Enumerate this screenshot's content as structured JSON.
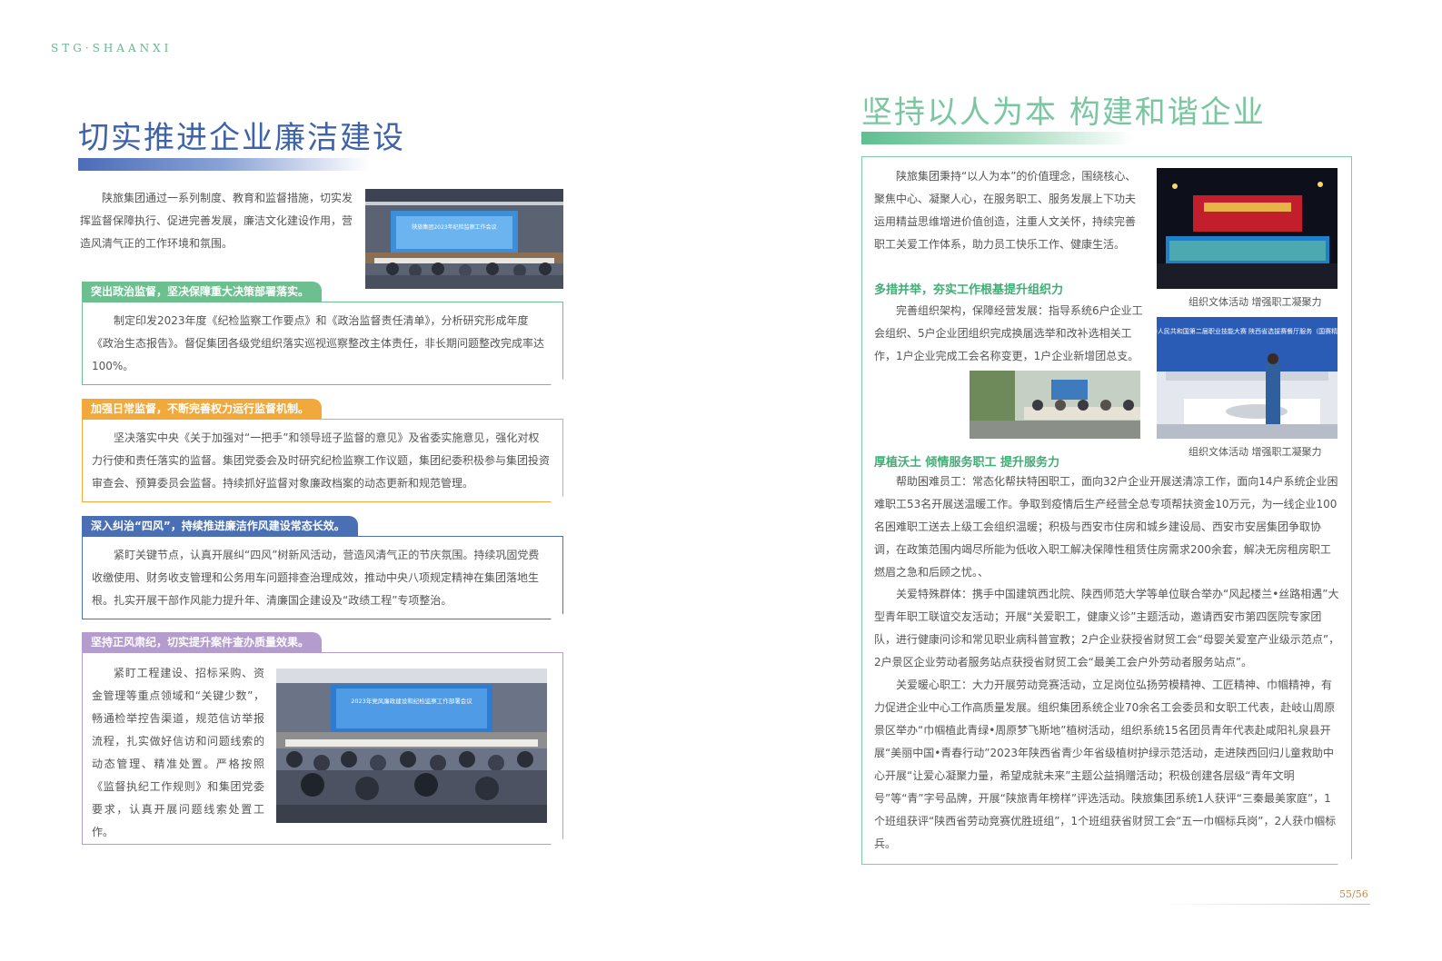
{
  "brand": "STG·SHAANXI",
  "left": {
    "title": "切实推进企业廉洁建设",
    "intro": "陕旅集团通过一系列制度、教育和监督措施，切实发挥监督保障执行、促进完善发展，廉洁文化建设作用，营造风清气正的工作环境和氛围。",
    "sections": [
      {
        "heading": "突出政治监督，坚决保障重大决策部署落实。",
        "body": "制定印发2023年度《纪检监察工作要点》和《政治监督责任清单》，分析研究形成年度《政治生态报告》。督促集团各级党组织落实巡视巡察整改主体责任，非长期问题整改完成率达100%。",
        "color": "#6cbf8f"
      },
      {
        "heading": "加强日常监督，不断完善权力运行监督机制。",
        "body": "坚决落实中央《关于加强对“一把手”和领导班子监督的意见》及省委实施意见，强化对权力行使和责任落实的监督。集团党委会及时研究纪检监察工作议题，集团纪委积极参与集团投资审查会、预算委员会监督。持续抓好监督对象廉政档案的动态更新和规范管理。",
        "color": "#f2a93b"
      },
      {
        "heading": "深入纠治“四风”，持续推进廉洁作风建设常态长效。",
        "body": "紧盯关键节点，认真开展纠“四风”树新风活动，营造风清气正的节庆氛围。持续巩固党费收缴使用、财务收支管理和公务用车问题排查治理成效，推动中央八项规定精神在集团落地生根。扎实开展干部作风能力提升年、清廉国企建设及“政绩工程”专项整治。",
        "color": "#4a6fb5"
      },
      {
        "heading": "坚持正风肃纪，切实提升案件查办质量效果。",
        "body": "紧盯工程建设、招标采购、资金管理等重点领域和“关键少数”，畅通检举控告渠道，规范信访举报流程，扎实做好信访和问题线索的动态管理、精准处置。严格按照《监督执纪工作规则》和集团党委要求，认真开展问题线索处置工作。",
        "color": "#b49ccf"
      }
    ],
    "photo_top_banner": "陕旅集团2023年纪检监察工作会议",
    "photo_bottom_banner": "2023年党风廉政建设和纪检监察工作部署会议"
  },
  "right": {
    "title": "坚持以人为本 构建和谐企业",
    "intro": "陕旅集团秉持“以人为本”的价值理念，围绕核心、聚焦中心、凝聚人心，在服务职工、服务发展上下功夫运用精益思维增进价值创造，注重人文关怀，持续完善职工关爱工作体系，助力员工快乐工作、健康生活。",
    "heading1": "多措并举，夯实工作根基提升组织力",
    "para1": "完善组织架构，保障经营发展：指导系统6户企业工会组织、5户企业团组织完成换届选举和改补选相关工作，1户企业完成工会名称变更，1户企业新增团总支。",
    "caption1": "组织文体活动 增强职工凝聚力",
    "caption2": "组织文体活动 增强职工凝聚力",
    "photo2_banner": "中华人民共和国第二届职业技能大赛 陕西省选拔赛餐厅服务（国赛精选）",
    "heading2": "厚植沃土 倾情服务职工 提升服务力",
    "para2": "帮助困难员工：常态化帮扶特困职工，面向32户企业开展送清凉工作，面向14户系统企业困难职工53名开展送温暖工作。争取到疫情后生产经营全总专项帮扶资金10万元，为一线企业100名困难职工送去上级工会组织温暖；积极与西安市住房和城乡建设局、西安市安居集团争取协调，在政策范围内竭尽所能为低收入职工解决保障性租赁住房需求200余套，解决无房租房职工燃眉之急和后顾之忧。、",
    "para3": "关爱特殊群体：携手中国建筑西北院、陕西师范大学等单位联合举办“风起楼兰•丝路相遇”大型青年职工联谊交友活动；开展“关爱职工，健康义诊”主题活动，邀请西安市第四医院专家团队，进行健康问诊和常见职业病科普宣教；2户企业获授省财贸工会“母婴关爱室产业级示范点”，2户景区企业劳动者服务站点获授省财贸工会“最美工会户外劳动者服务站点”。",
    "para4": "关爱暖心职工：大力开展劳动竞赛活动，立足岗位弘扬劳模精神、工匠精神、巾帼精神，有力促进企业中心工作高质量发展。组织集团系统企业70余名工会委员和女职工代表，赴岐山周原景区举办“巾帼植此青绿•周原梦飞斯地”植树活动，组织系统15名团员青年代表赴咸阳礼泉县开展“美丽中国•青春行动”2023年陕西省青少年省级植树护绿示范活动，走进陕西回归儿童救助中心开展“让爱心凝聚力量，希望成就未来”主题公益捐赠活动；积极创建各层级“青年文明号”等“青”字号品牌，开展“陕旅青年榜样”评选活动。陕旅集团系统1人获评“三秦最美家庭”，1个班组获评“陕西省劳动竞赛优胜班组”，1个班组获省财贸工会“五一巾帼标兵岗”，2人获巾帼标兵。"
  },
  "page_number": "55/56",
  "colors": {
    "left_accent": "#3e63a8",
    "right_accent": "#79c7a0",
    "right_heading": "#3fae74",
    "page_number": "#c08a4a"
  }
}
